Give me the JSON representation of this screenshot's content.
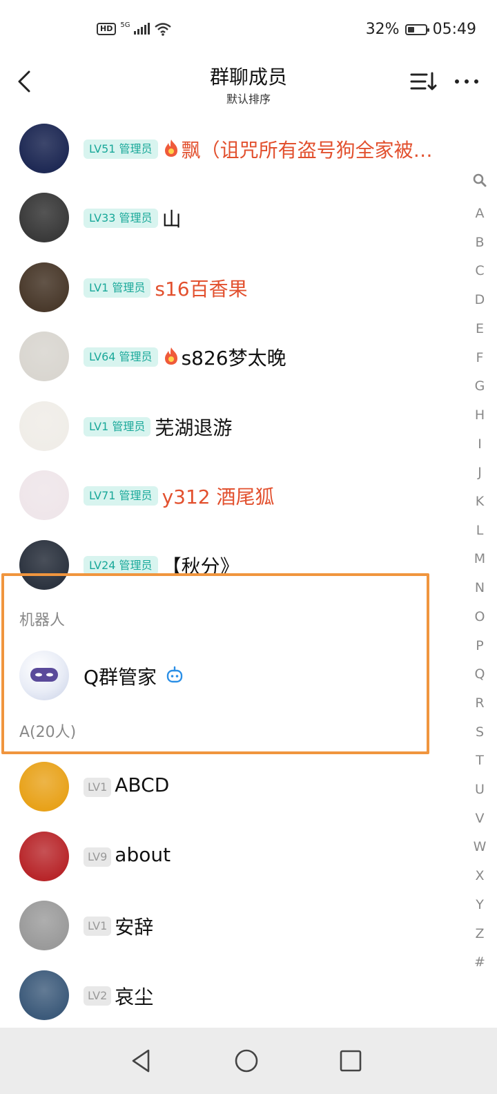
{
  "status_bar": {
    "hd": "HD",
    "network": "5G",
    "battery_pct": "32%",
    "time": "05:49"
  },
  "header": {
    "title": "群聊成员",
    "subtitle": "默认排序"
  },
  "admins": [
    {
      "level": "LV51 管理员",
      "name": "飘（诅咒所有盗号狗全家被…",
      "color": "red",
      "flame": true,
      "avatar_color": "#1f2a55"
    },
    {
      "level": "LV33 管理员",
      "name": "山",
      "color": "black",
      "flame": false,
      "avatar_color": "#3a3a3a"
    },
    {
      "level": "LV1 管理员",
      "name": "s16百香果",
      "color": "red",
      "flame": false,
      "avatar_color": "#4a3a2c"
    },
    {
      "level": "LV64 管理员",
      "name": "s826梦太晚",
      "color": "black",
      "flame": true,
      "avatar_color": "#d9d6d0"
    },
    {
      "level": "LV1 管理员",
      "name": "芜湖退游",
      "color": "black",
      "flame": false,
      "avatar_color": "#f0ede8"
    },
    {
      "level": "LV71 管理员",
      "name": "y312 酒尾狐",
      "color": "red",
      "flame": false,
      "avatar_color": "#efe6ea"
    },
    {
      "level": "LV24 管理员",
      "name": "【秋分》",
      "color": "black",
      "flame": false,
      "avatar_color": "#2d3440"
    }
  ],
  "robot_section": {
    "label": "机器人",
    "name": "Q群管家"
  },
  "a_section": {
    "label": "A(20人)",
    "members": [
      {
        "level": "LV1",
        "name": "ABCD",
        "avatar_color": "#e8a21a"
      },
      {
        "level": "LV9",
        "name": "about",
        "avatar_color": "#b8262a"
      },
      {
        "level": "LV1",
        "name": "安辞",
        "avatar_color": "#9a9a9a"
      },
      {
        "level": "LV2",
        "name": "哀尘",
        "avatar_color": "#3c5a7a"
      }
    ]
  },
  "index_letters": [
    "A",
    "B",
    "C",
    "D",
    "E",
    "F",
    "G",
    "H",
    "I",
    "J",
    "K",
    "L",
    "M",
    "N",
    "O",
    "P",
    "Q",
    "R",
    "S",
    "T",
    "U",
    "V",
    "W",
    "X",
    "Y",
    "Z",
    "#"
  ],
  "colors": {
    "admin_badge_bg": "#d8f4ef",
    "admin_badge_text": "#19a899",
    "red_name": "#e2502e",
    "highlight": "#f0953e"
  },
  "icons": {
    "back": "chevron-left-icon",
    "sort": "sort-list-icon",
    "more": "more-dots-icon",
    "search": "search-icon",
    "flame": "flame-icon",
    "robot": "robot-icon"
  }
}
